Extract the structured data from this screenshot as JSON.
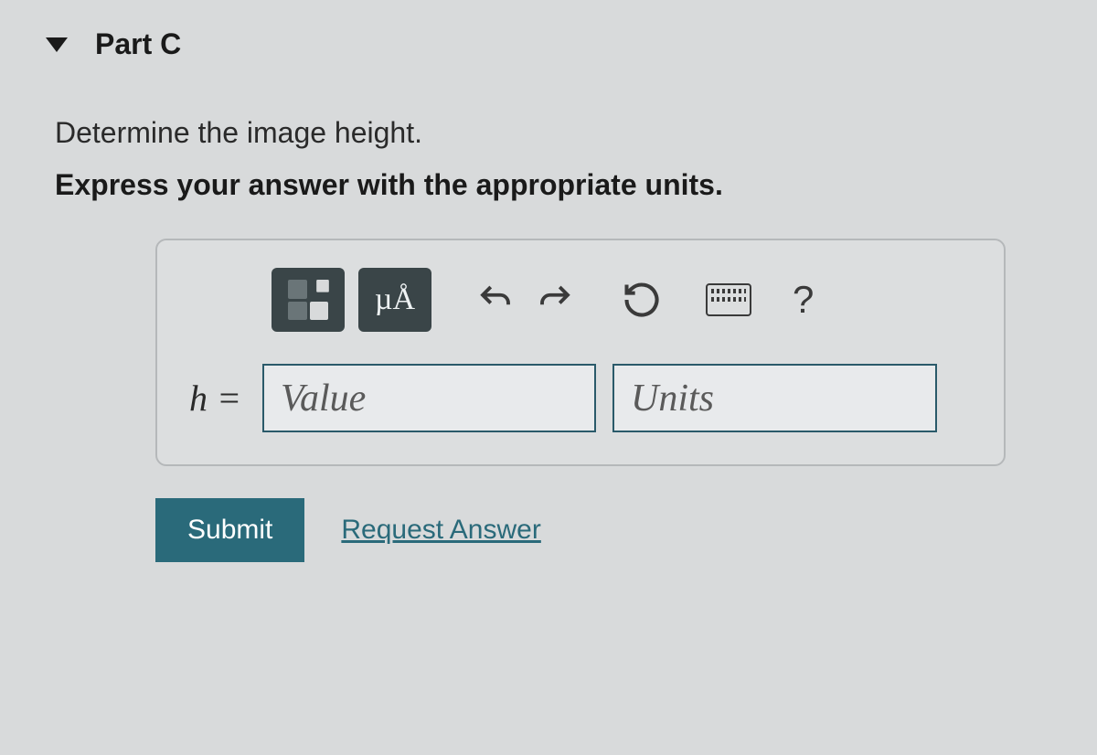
{
  "part": {
    "label": "Part C"
  },
  "question": {
    "prompt": "Determine the image height.",
    "instruction": "Express your answer with the appropriate units."
  },
  "toolbar": {
    "templates_name": "templates-icon",
    "special_chars_label": "µÅ",
    "undo_name": "undo-icon",
    "redo_name": "redo-icon",
    "reset_name": "reset-icon",
    "keyboard_name": "keyboard-icon",
    "help_label": "?"
  },
  "answer": {
    "variable": "h =",
    "value_placeholder": "Value",
    "units_placeholder": "Units"
  },
  "actions": {
    "submit": "Submit",
    "request": "Request Answer"
  }
}
